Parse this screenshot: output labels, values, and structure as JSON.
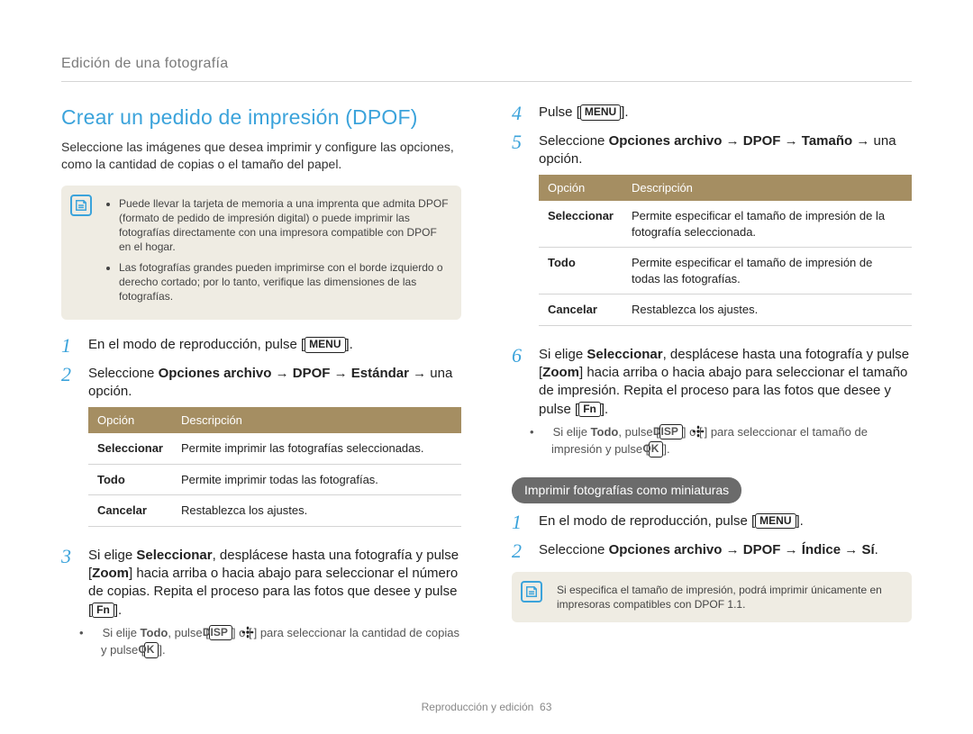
{
  "header": {
    "title": "Edición de una fotografía"
  },
  "h1": "Crear un pedido de impresión (DPOF)",
  "intro": "Seleccione las imágenes que desea imprimir y configure las opciones, como la cantidad de copias o el tamaño del papel.",
  "notebox1": {
    "items": [
      "Puede llevar la tarjeta de memoria a una imprenta que admita DPOF (formato de pedido de impresión digital) o puede imprimir las fotografías directamente con una impresora compatible con DPOF en el hogar.",
      "Las fotografías grandes pueden imprimirse con el borde izquierdo o derecho cortado; por lo tanto, verifique las dimensiones de las fotografías."
    ]
  },
  "left": {
    "step1_a": "En el modo de reproducción, pulse [",
    "step1_btn": "MENU",
    "step1_b": "].",
    "step2_a": "Seleccione ",
    "step2_bold": "Opciones archivo → DPOF → Estándar →",
    "step2_b": " una opción.",
    "table": {
      "col1": "Opción",
      "col2": "Descripción",
      "rows": [
        {
          "opt": "Seleccionar",
          "desc": "Permite imprimir las fotografías seleccionadas."
        },
        {
          "opt": "Todo",
          "desc": "Permite imprimir todas las fotografías."
        },
        {
          "opt": "Cancelar",
          "desc": "Restablezca los ajustes."
        }
      ]
    },
    "step3_a": "Si elige ",
    "step3_sel": "Seleccionar",
    "step3_b": ", desplácese hasta una fotografía y pulse [",
    "step3_zoom": "Zoom",
    "step3_c": "] hacia arriba o hacia abajo para seleccionar el número de copias. Repita el proceso para las fotos que desee y pulse [",
    "step3_fn": "Fn",
    "step3_d": "].",
    "step3_sub_a": "Si elije ",
    "step3_sub_todo": "Todo",
    "step3_sub_b": ", pulse [",
    "step3_sub_disp": "DISP",
    "step3_sub_c": "] o [",
    "step3_sub_d": "] para seleccionar la cantidad de copias y pulse [",
    "step3_sub_ok": "OK",
    "step3_sub_e": "]."
  },
  "right": {
    "step4_a": "Pulse [",
    "step4_btn": "MENU",
    "step4_b": "].",
    "step5_a": "Seleccione ",
    "step5_bold": "Opciones archivo → DPOF → Tamaño →",
    "step5_b": " una opción.",
    "table": {
      "col1": "Opción",
      "col2": "Descripción",
      "rows": [
        {
          "opt": "Seleccionar",
          "desc": "Permite especificar el tamaño de impresión de la fotografía seleccionada."
        },
        {
          "opt": "Todo",
          "desc": "Permite especificar el tamaño de impresión de todas las fotografías."
        },
        {
          "opt": "Cancelar",
          "desc": "Restablezca los ajustes."
        }
      ]
    },
    "step6_a": "Si elige ",
    "step6_sel": "Seleccionar",
    "step6_b": ", desplácese hasta una fotografía y pulse [",
    "step6_zoom": "Zoom",
    "step6_c": "] hacia arriba o hacia abajo para seleccionar el tamaño de impresión. Repita el proceso para las fotos que desee y pulse [",
    "step6_fn": "Fn",
    "step6_d": "].",
    "step6_sub_a": "Si elije ",
    "step6_sub_todo": "Todo",
    "step6_sub_b": ", pulse [",
    "step6_sub_disp": "DISP",
    "step6_sub_c": "] o [",
    "step6_sub_d": "] para seleccionar el tamaño de impresión y pulse [",
    "step6_sub_ok": "OK",
    "step6_sub_e": "].",
    "badge": "Imprimir fotografías como miniaturas",
    "mstep1_a": "En el modo de reproducción, pulse [",
    "mstep1_btn": "MENU",
    "mstep1_b": "].",
    "mstep2_a": "Seleccione ",
    "mstep2_bold": "Opciones archivo → DPOF → Índice → Sí",
    "mstep2_b": ".",
    "notebox2": "Si especifica el tamaño de impresión, podrá imprimir únicamente en impresoras compatibles con DPOF 1.1."
  },
  "footer": {
    "section": "Reproducción y edición",
    "page": "63"
  }
}
